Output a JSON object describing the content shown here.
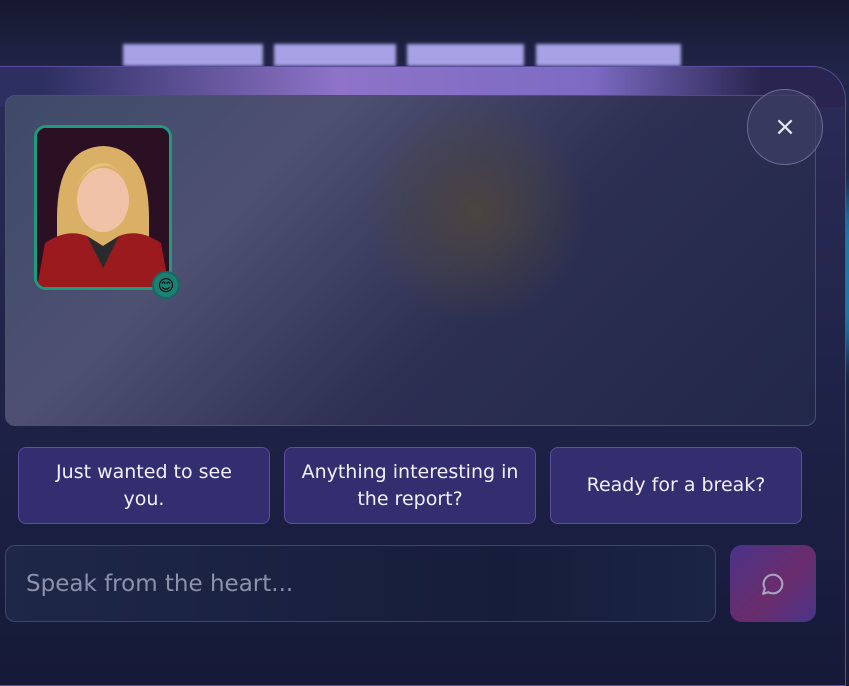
{
  "character": {
    "mood_emoji": "😊"
  },
  "close_label": "×",
  "suggestions": [
    "Just wanted to see you.",
    "Anything interesting in the report?",
    "Ready for a break?"
  ],
  "input": {
    "placeholder": "Speak from the heart...",
    "value": ""
  },
  "colors": {
    "accent": "#1f9a7f",
    "send_start": "#4a338a",
    "send_mid": "#6a2c6c"
  }
}
